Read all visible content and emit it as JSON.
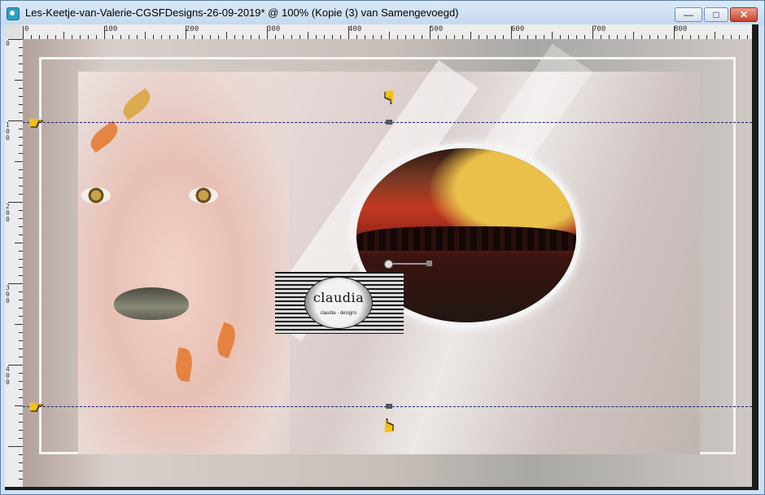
{
  "window": {
    "title": "Les-Keetje-van-Valerie-CGSFDesigns-26-09-2019* @ 100% (Kopie (3) van Samengevoegd)",
    "controls": {
      "minimize": "—",
      "maximize": "□",
      "close": "✕"
    }
  },
  "ruler": {
    "horizontal_labels": [
      "0",
      "100",
      "200",
      "300",
      "400",
      "500",
      "600",
      "700",
      "800"
    ],
    "vertical_labels": [
      "0",
      "100",
      "200",
      "300",
      "400"
    ]
  },
  "watermark": {
    "text": "claudia",
    "subtext": "claudia - designs"
  },
  "icons": {
    "hand_pointer": "pointing-hand-icon",
    "app": "image-document-icon"
  },
  "colors": {
    "guide": "#1a1a6a",
    "hand": "#f3c21a",
    "titlebar": "#c4d9ee",
    "close_button": "#c8412a"
  }
}
